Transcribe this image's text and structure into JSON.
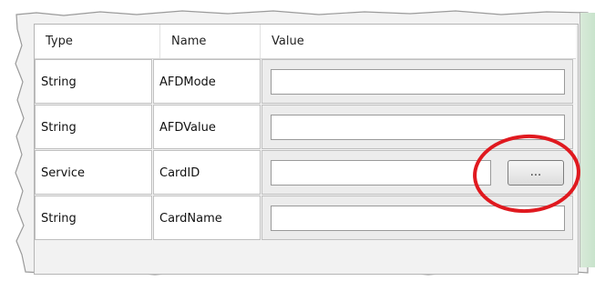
{
  "table": {
    "headers": {
      "type": "Type",
      "name": "Name",
      "value": "Value"
    },
    "rows": [
      {
        "type": "String",
        "name": "AFDMode",
        "value": ""
      },
      {
        "type": "String",
        "name": "AFDValue",
        "value": ""
      },
      {
        "type": "Service",
        "name": "CardID",
        "value": "",
        "browse_label": "..."
      },
      {
        "type": "String",
        "name": "CardName",
        "value": ""
      }
    ]
  },
  "colors": {
    "highlight_circle": "#e0191f",
    "side_strip": "#c8e3cc"
  }
}
